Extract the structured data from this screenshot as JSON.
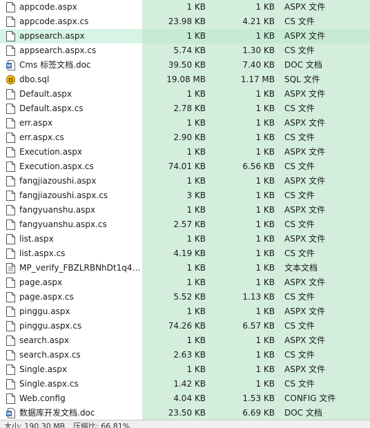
{
  "files": [
    {
      "name": "appcode.aspx",
      "size": "1 KB",
      "packed": "1 KB",
      "type": "ASPX 文件",
      "icon": "file-icon"
    },
    {
      "name": "appcode.aspx.cs",
      "size": "23.98 KB",
      "packed": "4.21 KB",
      "type": "CS 文件",
      "icon": "file-icon"
    },
    {
      "name": "appsearch.aspx",
      "size": "1 KB",
      "packed": "1 KB",
      "type": "ASPX 文件",
      "icon": "file-icon",
      "selected": true
    },
    {
      "name": "appsearch.aspx.cs",
      "size": "5.74 KB",
      "packed": "1.30 KB",
      "type": "CS 文件",
      "icon": "file-icon"
    },
    {
      "name": "Cms 标签文档.doc",
      "size": "39.50 KB",
      "packed": "7.40 KB",
      "type": "DOC 文档",
      "icon": "doc-icon"
    },
    {
      "name": "dbo.sql",
      "size": "19.08 MB",
      "packed": "1.17 MB",
      "type": "SQL 文件",
      "icon": "sql-icon"
    },
    {
      "name": "Default.aspx",
      "size": "1 KB",
      "packed": "1 KB",
      "type": "ASPX 文件",
      "icon": "file-icon"
    },
    {
      "name": "Default.aspx.cs",
      "size": "2.78 KB",
      "packed": "1 KB",
      "type": "CS 文件",
      "icon": "file-icon"
    },
    {
      "name": "err.aspx",
      "size": "1 KB",
      "packed": "1 KB",
      "type": "ASPX 文件",
      "icon": "file-icon"
    },
    {
      "name": "err.aspx.cs",
      "size": "2.90 KB",
      "packed": "1 KB",
      "type": "CS 文件",
      "icon": "file-icon"
    },
    {
      "name": "Execution.aspx",
      "size": "1 KB",
      "packed": "1 KB",
      "type": "ASPX 文件",
      "icon": "file-icon"
    },
    {
      "name": "Execution.aspx.cs",
      "size": "74.01 KB",
      "packed": "6.56 KB",
      "type": "CS 文件",
      "icon": "file-icon"
    },
    {
      "name": "fangjiazoushi.aspx",
      "size": "1 KB",
      "packed": "1 KB",
      "type": "ASPX 文件",
      "icon": "file-icon"
    },
    {
      "name": "fangjiazoushi.aspx.cs",
      "size": "3 KB",
      "packed": "1 KB",
      "type": "CS 文件",
      "icon": "file-icon"
    },
    {
      "name": "fangyuanshu.aspx",
      "size": "1 KB",
      "packed": "1 KB",
      "type": "ASPX 文件",
      "icon": "file-icon"
    },
    {
      "name": "fangyuanshu.aspx.cs",
      "size": "2.57 KB",
      "packed": "1 KB",
      "type": "CS 文件",
      "icon": "file-icon"
    },
    {
      "name": "list.aspx",
      "size": "1 KB",
      "packed": "1 KB",
      "type": "ASPX 文件",
      "icon": "file-icon"
    },
    {
      "name": "list.aspx.cs",
      "size": "4.19 KB",
      "packed": "1 KB",
      "type": "CS 文件",
      "icon": "file-icon"
    },
    {
      "name": "MP_verify_FBZLRBNhDt1q4Li...",
      "size": "1 KB",
      "packed": "1 KB",
      "type": "文本文档",
      "icon": "text-icon"
    },
    {
      "name": "page.aspx",
      "size": "1 KB",
      "packed": "1 KB",
      "type": "ASPX 文件",
      "icon": "file-icon"
    },
    {
      "name": "page.aspx.cs",
      "size": "5.52 KB",
      "packed": "1.13 KB",
      "type": "CS 文件",
      "icon": "file-icon"
    },
    {
      "name": "pinggu.aspx",
      "size": "1 KB",
      "packed": "1 KB",
      "type": "ASPX 文件",
      "icon": "file-icon"
    },
    {
      "name": "pinggu.aspx.cs",
      "size": "74.26 KB",
      "packed": "6.57 KB",
      "type": "CS 文件",
      "icon": "file-icon"
    },
    {
      "name": "search.aspx",
      "size": "1 KB",
      "packed": "1 KB",
      "type": "ASPX 文件",
      "icon": "file-icon"
    },
    {
      "name": "search.aspx.cs",
      "size": "2.63 KB",
      "packed": "1 KB",
      "type": "CS 文件",
      "icon": "file-icon"
    },
    {
      "name": "Single.aspx",
      "size": "1 KB",
      "packed": "1 KB",
      "type": "ASPX 文件",
      "icon": "file-icon"
    },
    {
      "name": "Single.aspx.cs",
      "size": "1.42 KB",
      "packed": "1 KB",
      "type": "CS 文件",
      "icon": "file-icon"
    },
    {
      "name": "Web.config",
      "size": "4.04 KB",
      "packed": "1.53 KB",
      "type": "CONFIG 文件",
      "icon": "file-icon"
    },
    {
      "name": "数据库开发文档.doc",
      "size": "23.50 KB",
      "packed": "6.69 KB",
      "type": "DOC 文档",
      "icon": "doc-icon"
    }
  ],
  "statusbar": {
    "left": "大小: 190.30 MB",
    "right": "压缩比: 66.81%"
  },
  "colors": {
    "detail_columns_bg": "#d3eedc",
    "selected_row_bg": "#d6f5e4",
    "doc_icon": "#2b5fb0",
    "sql_icon_bg": "#f2c200"
  }
}
